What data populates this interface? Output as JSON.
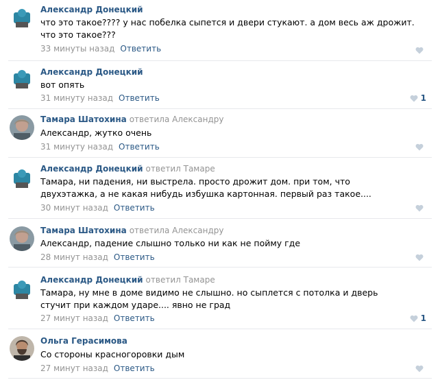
{
  "reply_label": "Ответить",
  "colors": {
    "author": "#2a5885",
    "meta": "#939393",
    "heart": "#c5d0db",
    "divider": "#e7e8ec"
  },
  "comments": [
    {
      "author": "Александр Донецкий",
      "reply_to": "",
      "text": "что это такое???? у нас побелка сыпется и двери стукают. а дом весь аж дрожит. что это такое???",
      "time": "33 минуты назад",
      "likes": "",
      "avatar": "avatar-a"
    },
    {
      "author": "Александр Донецкий",
      "reply_to": "",
      "text": "вот опять",
      "time": "31 минуту назад",
      "likes": "1",
      "avatar": "avatar-a"
    },
    {
      "author": "Тамара Шатохина",
      "reply_to": "ответила Александру",
      "text": "Александр, жутко очень",
      "time": "31 минуту назад",
      "likes": "",
      "avatar": "avatar-t"
    },
    {
      "author": "Александр Донецкий",
      "reply_to": "ответил Тамаре",
      "text": "Тамара, ни падения, ни выстрела. просто дрожит дом. при том, что двухэтажка, а не какая нибудь избушка картонная. первый раз такое....",
      "time": "30 минут назад",
      "likes": "",
      "avatar": "avatar-a"
    },
    {
      "author": "Тамара Шатохина",
      "reply_to": "ответила Александру",
      "text": "Александр, падение слышно только ни как не пойму где",
      "time": "28 минут назад",
      "likes": "",
      "avatar": "avatar-t"
    },
    {
      "author": "Александр Донецкий",
      "reply_to": "ответил Тамаре",
      "text": "Тамара, ну мне в доме видимо не слышно. но сыплется с потолка и дверь стучит при каждом ударе.... явно не град",
      "time": "27 минут назад",
      "likes": "1",
      "avatar": "avatar-a"
    },
    {
      "author": "Ольга Герасимова",
      "reply_to": "",
      "text": "Со стороны красногоровки дым",
      "time": "27 минут назад",
      "likes": "",
      "avatar": "avatar-o"
    }
  ]
}
